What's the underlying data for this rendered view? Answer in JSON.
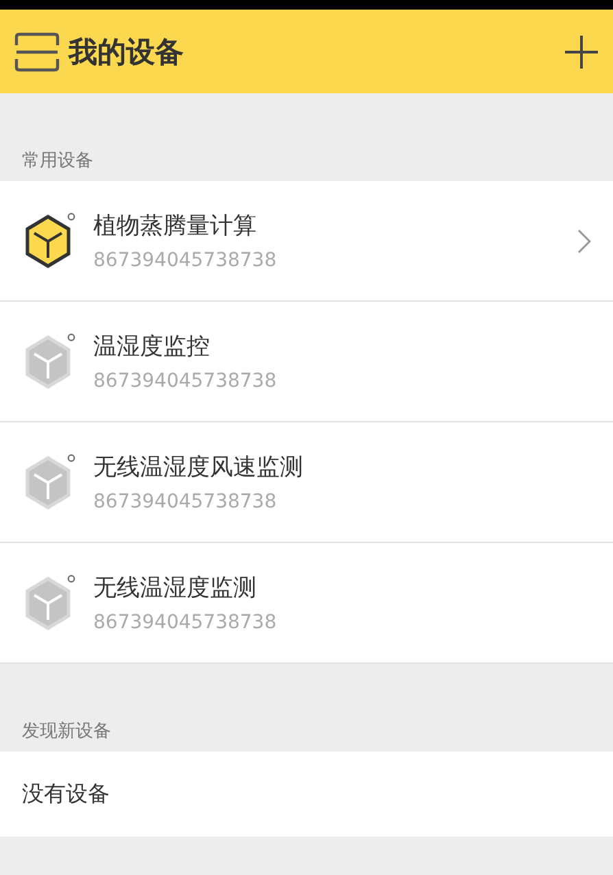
{
  "header": {
    "title": "我的设备"
  },
  "sections": [
    {
      "title": "常用设备",
      "devices": [
        {
          "name": "植物蒸腾量计算",
          "id": "867394045738738",
          "online": true
        },
        {
          "name": "温湿度监控",
          "id": "867394045738738",
          "online": false
        },
        {
          "name": "无线温湿度风速监测",
          "id": "867394045738738",
          "online": false
        },
        {
          "name": "无线温湿度监测",
          "id": "867394045738738",
          "online": false
        }
      ]
    },
    {
      "title": "发现新设备",
      "empty_text": "没有设备"
    }
  ]
}
